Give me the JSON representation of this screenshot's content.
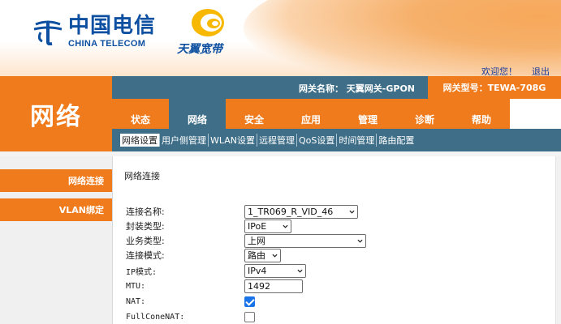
{
  "header": {
    "brand_cn": "中国电信",
    "brand_en": "CHINA TELECOM",
    "tianyi_label": "天翼宽带",
    "welcome": "欢迎您！",
    "logout": "退出"
  },
  "left_title": "网络",
  "gateway": {
    "name_label": "网关名称： 天翼网关-GPON",
    "model_label": "网关型号：TEWA-708G"
  },
  "nav": {
    "tabs": [
      {
        "label": "状态"
      },
      {
        "label": "网络"
      },
      {
        "label": "安全"
      },
      {
        "label": "应用"
      },
      {
        "label": "管理"
      },
      {
        "label": "诊断"
      },
      {
        "label": "帮助"
      }
    ],
    "active_index": 1
  },
  "subnav": {
    "items": [
      {
        "label": "网络设置"
      },
      {
        "label": "用户侧管理"
      },
      {
        "label": "WLAN设置"
      },
      {
        "label": "远程管理"
      },
      {
        "label": "QoS设置"
      },
      {
        "label": "时间管理"
      },
      {
        "label": "路由配置"
      }
    ]
  },
  "left_menu": {
    "items": [
      {
        "label": "网络连接"
      },
      {
        "label": "VLAN绑定"
      }
    ]
  },
  "content": {
    "title": "网络连接",
    "fields": {
      "connection_name": {
        "label": "连接名称:",
        "value": "1_TR069_R_VID_46"
      },
      "encapsulation": {
        "label": "封装类型:",
        "value": "IPoE"
      },
      "service_type": {
        "label": "业务类型:",
        "value": "上网"
      },
      "connection_mode": {
        "label": "连接模式:",
        "value": "路由"
      },
      "ip_mode": {
        "label": "IP模式:",
        "value": "IPv4"
      },
      "mtu": {
        "label": "MTU:",
        "value": "1492"
      },
      "nat": {
        "label": "NAT:",
        "checked": true
      },
      "fullcone_nat": {
        "label": "FullConeNAT:",
        "checked": false
      }
    }
  },
  "colors": {
    "orange": "#ef7b1d",
    "steel_blue": "#3f6f88",
    "brand_blue": "#0d4fa0",
    "checkbox_blue": "#1a73e8"
  }
}
